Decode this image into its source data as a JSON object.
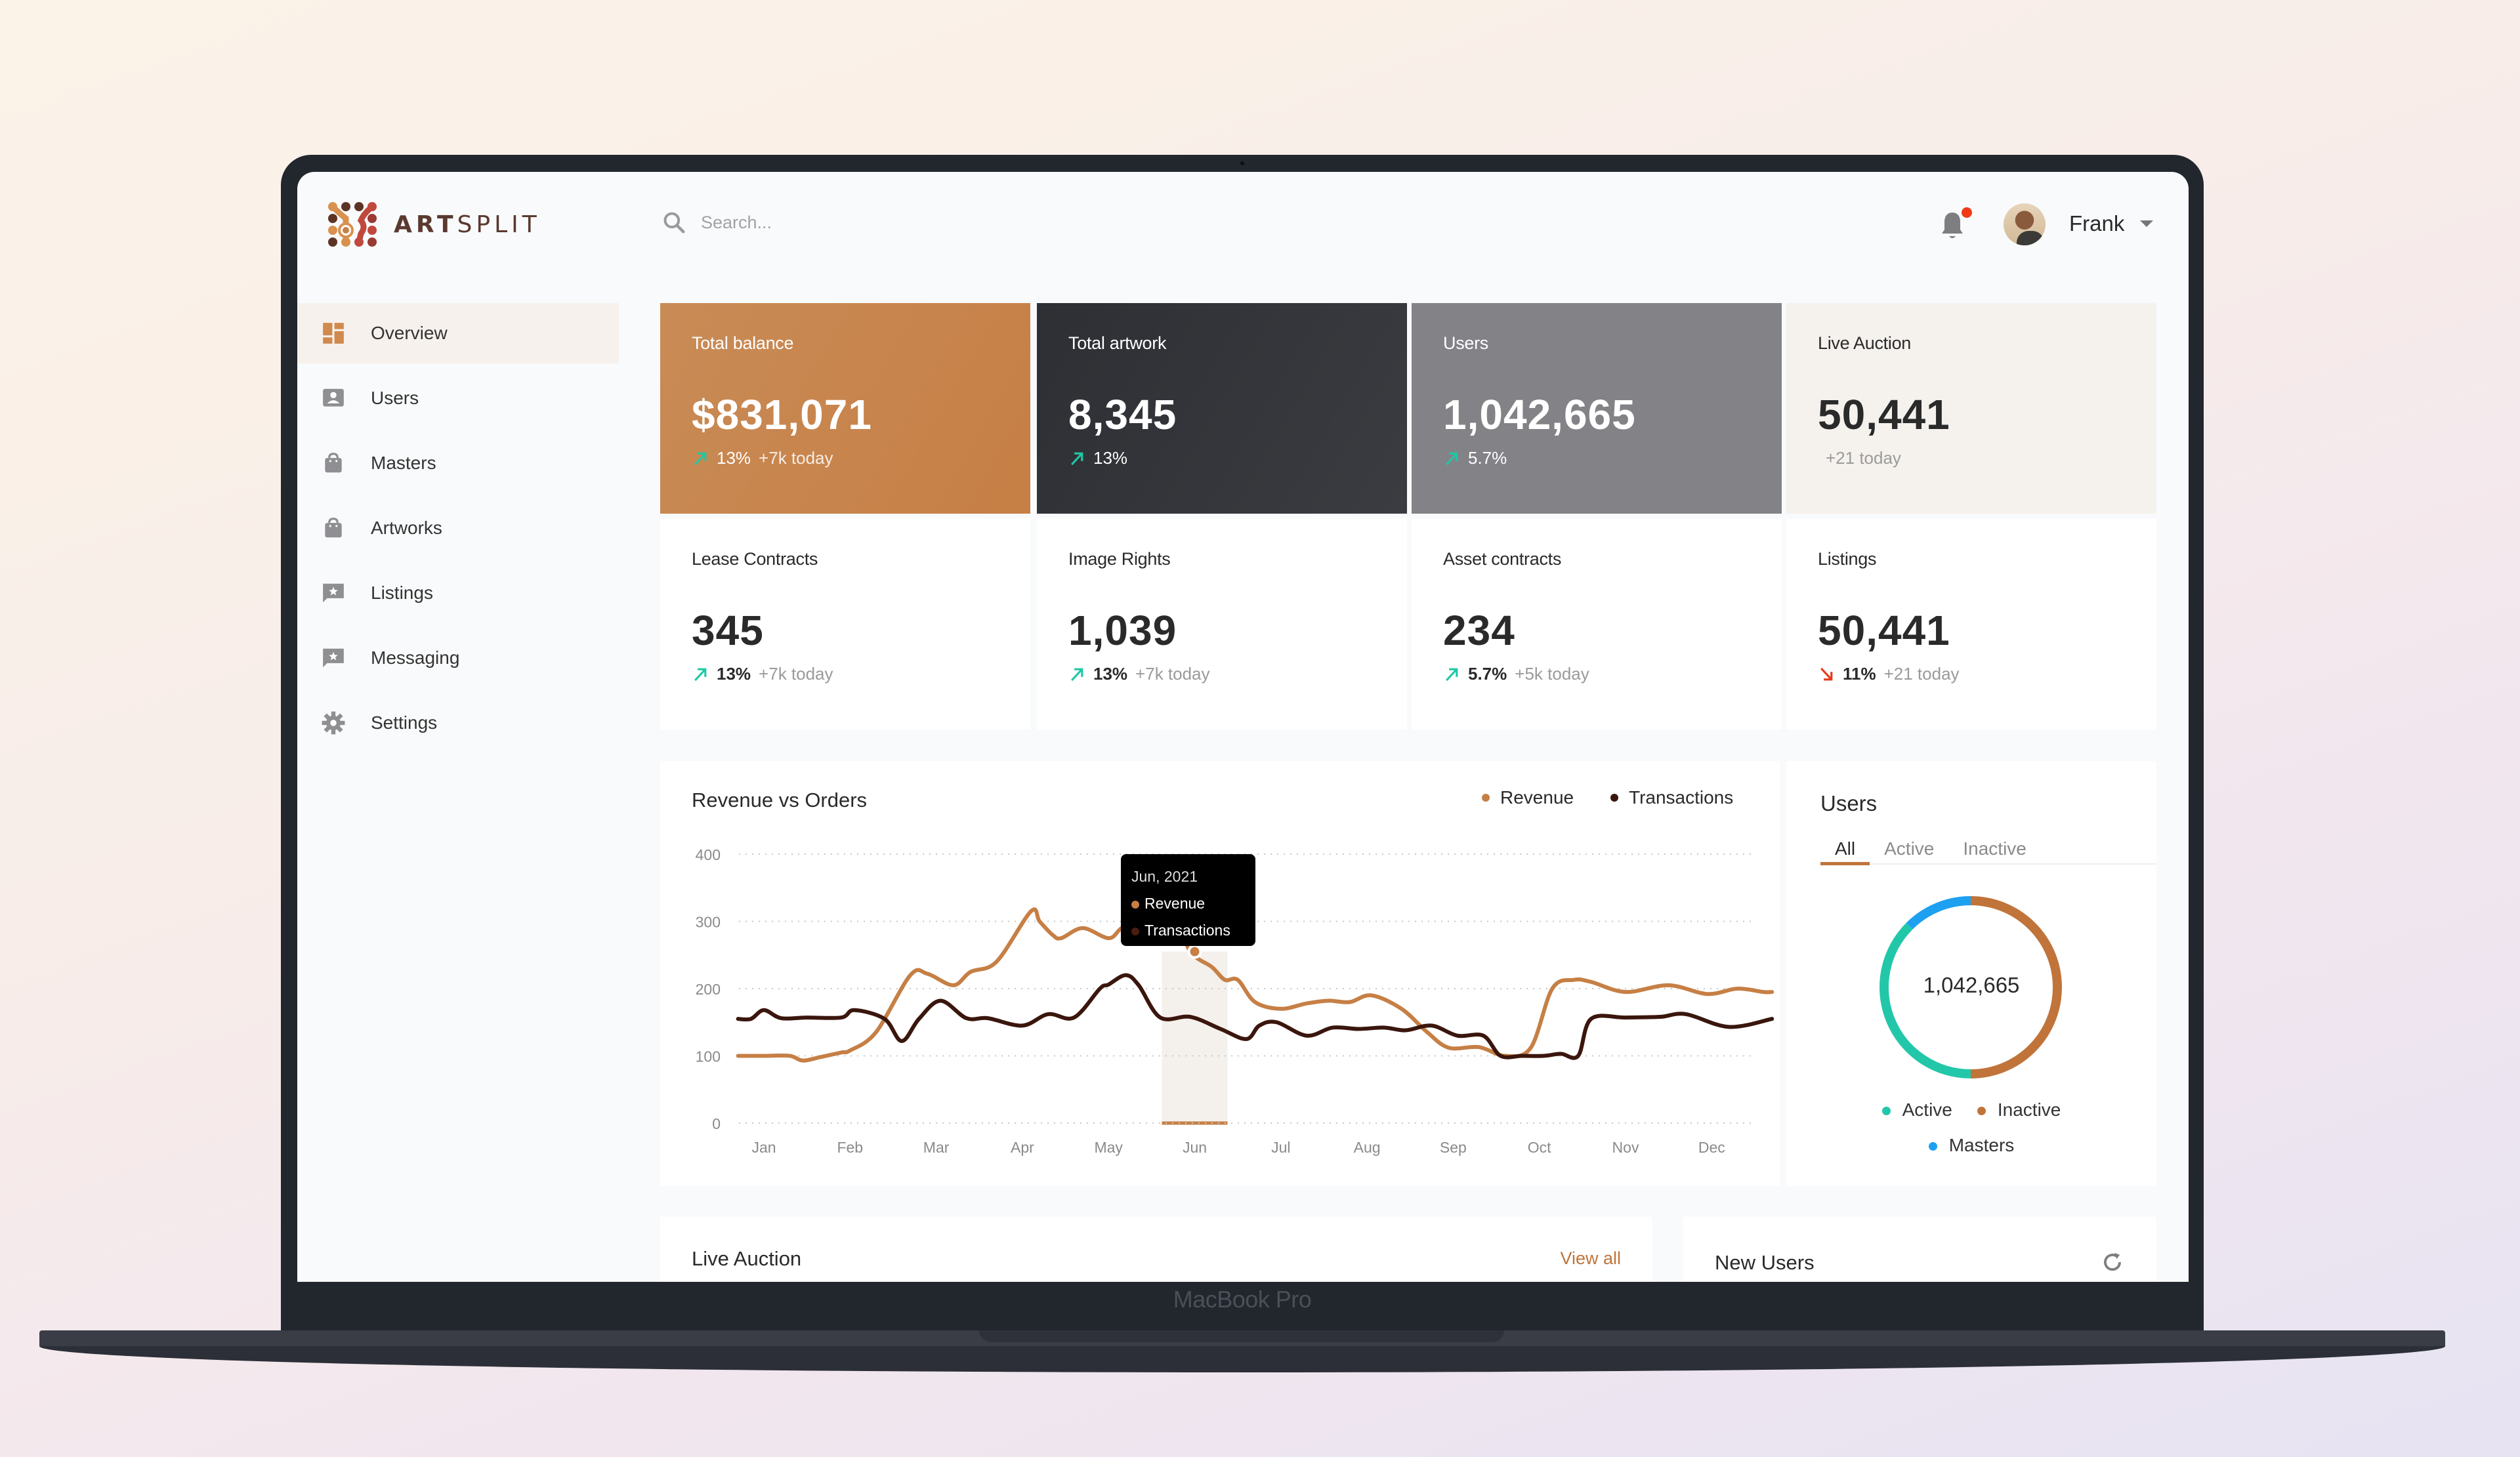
{
  "device_label": "MacBook Pro",
  "header": {
    "brand_bold": "ART",
    "brand_light": "SPLIT",
    "search_placeholder": "Search...",
    "user_name": "Frank",
    "notification_dot": true
  },
  "sidebar": {
    "items": [
      {
        "label": "Overview",
        "icon": "dashboard-icon",
        "active": true
      },
      {
        "label": "Users",
        "icon": "user-card-icon"
      },
      {
        "label": "Masters",
        "icon": "bag-icon"
      },
      {
        "label": "Artworks",
        "icon": "bag-icon"
      },
      {
        "label": "Listings",
        "icon": "star-message-icon"
      },
      {
        "label": "Messaging",
        "icon": "star-message-icon"
      },
      {
        "label": "Settings",
        "icon": "gear-icon"
      }
    ]
  },
  "stats": [
    {
      "title": "Total balance",
      "value": "$831,071",
      "pct": "13%",
      "trend": "up",
      "sub": "+7k today"
    },
    {
      "title": "Total artwork",
      "value": "8,345",
      "pct": "13%",
      "trend": "up",
      "sub": ""
    },
    {
      "title": "Users",
      "value": "1,042,665",
      "pct": "5.7%",
      "trend": "up",
      "sub": ""
    },
    {
      "title": "Live Auction",
      "value": "50,441",
      "pct": "",
      "trend": "",
      "sub": "+21 today"
    },
    {
      "title": "Lease Contracts",
      "value": "345",
      "pct": "13%",
      "trend": "up",
      "sub": "+7k today"
    },
    {
      "title": "Image Rights",
      "value": "1,039",
      "pct": "13%",
      "trend": "up",
      "sub": "+7k today"
    },
    {
      "title": "Asset contracts",
      "value": "234",
      "pct": "5.7%",
      "trend": "up",
      "sub": "+5k today"
    },
    {
      "title": "Listings",
      "value": "50,441",
      "pct": "11%",
      "trend": "down",
      "sub": "+21 today"
    }
  ],
  "colors": {
    "accent": "#c0743a",
    "revenue": "#c67f45",
    "transactions": "#3a160d",
    "trend_up": "#1fc8a4",
    "trend_down": "#e8381a",
    "active": "#22c7a9",
    "inactive": "#c0743a",
    "masters": "#1ea0f0"
  },
  "chart_data": {
    "type": "line",
    "title": "Revenue vs Orders",
    "xlabel": "",
    "ylabel": "",
    "ylim": [
      0,
      400
    ],
    "yticks": [
      "0",
      "100",
      "200",
      "300",
      "400"
    ],
    "categories": [
      "Jan",
      "Feb",
      "Mar",
      "Apr",
      "May",
      "Jun",
      "Jul",
      "Aug",
      "Sep",
      "Oct",
      "Nov",
      "Dec"
    ],
    "grid": true,
    "legend_position": "top-right",
    "series": [
      {
        "name": "Revenue",
        "x": [
          -0.3,
          0.0,
          0.3,
          0.45,
          0.65,
          0.9,
          1.0,
          1.3,
          1.7,
          1.9,
          2.2,
          2.4,
          2.7,
          3.1,
          3.2,
          3.35,
          3.45,
          3.7,
          4.0,
          4.15,
          4.4,
          4.75,
          4.95,
          5.2,
          5.35,
          5.5,
          5.7,
          6.0,
          6.3,
          6.55,
          6.8,
          7.05,
          7.4,
          7.7,
          7.95,
          8.3,
          8.6,
          8.9,
          9.15,
          9.4,
          9.6,
          10.0,
          10.5,
          10.95,
          11.3,
          11.6,
          11.7
        ],
        "values": [
          100,
          100,
          100,
          93,
          98,
          105,
          108,
          135,
          220,
          222,
          205,
          225,
          240,
          315,
          300,
          280,
          275,
          290,
          275,
          290,
          312,
          310,
          255,
          232,
          213,
          213,
          180,
          170,
          178,
          182,
          180,
          190,
          170,
          135,
          112,
          113,
          100,
          112,
          200,
          213,
          210,
          195,
          205,
          192,
          200,
          195,
          195
        ]
      },
      {
        "name": "Transactions",
        "x": [
          -0.3,
          -0.15,
          0.0,
          0.2,
          0.5,
          0.9,
          1.05,
          1.4,
          1.6,
          1.8,
          2.05,
          2.35,
          2.6,
          3.0,
          3.3,
          3.6,
          3.9,
          4.0,
          4.2,
          4.35,
          4.6,
          4.95,
          5.3,
          5.6,
          5.75,
          5.95,
          6.3,
          6.6,
          6.9,
          7.2,
          7.45,
          7.75,
          8.05,
          8.35,
          8.55,
          8.8,
          9.05,
          9.25,
          9.45,
          9.6,
          10.0,
          10.4,
          10.7,
          11.2,
          11.7
        ],
        "values": [
          155,
          155,
          168,
          156,
          157,
          157,
          168,
          155,
          122,
          155,
          182,
          156,
          156,
          145,
          162,
          157,
          200,
          206,
          220,
          205,
          157,
          158,
          140,
          125,
          145,
          150,
          130,
          142,
          140,
          142,
          138,
          145,
          130,
          130,
          100,
          100,
          100,
          103,
          100,
          155,
          157,
          158,
          162,
          143,
          155
        ]
      }
    ],
    "highlight": {
      "category": "Jun",
      "tooltip_title": "Jun, 2021",
      "tooltip_items": [
        "Revenue",
        "Transactions"
      ],
      "marker_value": 255
    }
  },
  "users_panel": {
    "title": "Users",
    "tabs": [
      "All",
      "Active",
      "Inactive"
    ],
    "active_tab": "All",
    "total": "1,042,665",
    "segments": [
      {
        "name": "Inactive",
        "share": 0.5
      },
      {
        "name": "Active",
        "share": 0.375
      },
      {
        "name": "Masters",
        "share": 0.125
      }
    ],
    "legend": [
      "Active",
      "Inactive",
      "Masters"
    ]
  },
  "live_auction": {
    "title": "Live Auction",
    "view_all": "View all"
  },
  "new_users": {
    "title": "New Users"
  }
}
